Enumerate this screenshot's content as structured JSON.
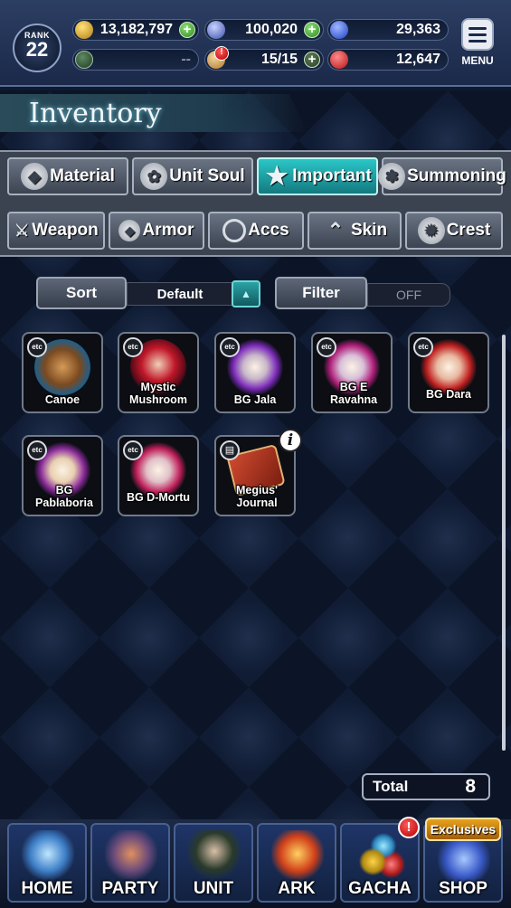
{
  "header": {
    "rank_label": "RANK",
    "rank_value": "22",
    "gold": "13,182,797",
    "gems": "100,020",
    "blue_orbs": "29,363",
    "secondary_currency": "--",
    "stamina": "15/15",
    "red_orbs": "12,647",
    "menu_label": "MENU"
  },
  "page": {
    "title": "Inventory"
  },
  "categories": {
    "row1": [
      {
        "label": "Material",
        "icon": "sack-icon"
      },
      {
        "label": "Unit Soul",
        "icon": "flame-icon"
      },
      {
        "label": "Important",
        "icon": "star-icon",
        "active": true
      },
      {
        "label": "Summoning",
        "icon": "summon-icon"
      }
    ],
    "row2": [
      {
        "label": "Weapon",
        "icon": "sword-icon"
      },
      {
        "label": "Armor",
        "icon": "armor-icon"
      },
      {
        "label": "Accs",
        "icon": "ring-icon"
      },
      {
        "label": "Skin",
        "icon": "hanger-icon"
      },
      {
        "label": "Crest",
        "icon": "crest-icon"
      }
    ]
  },
  "controls": {
    "sort_label": "Sort",
    "sort_value": "Default",
    "filter_label": "Filter",
    "filter_value": "OFF"
  },
  "items": [
    {
      "name": "Canoe",
      "badge": "etc"
    },
    {
      "name": "Mystic Mushroom",
      "badge": "etc"
    },
    {
      "name": "BG Jala",
      "badge": "etc"
    },
    {
      "name": "BG E Ravahna",
      "badge": "etc"
    },
    {
      "name": "BG Dara",
      "badge": "etc"
    },
    {
      "name": "BG Pablaboria",
      "badge": "etc"
    },
    {
      "name": "BG D-Mortu",
      "badge": "etc"
    },
    {
      "name": "Megius' Journal",
      "badge": "book"
    }
  ],
  "total": {
    "label": "Total",
    "value": "8"
  },
  "nav": [
    {
      "label": "HOME"
    },
    {
      "label": "PARTY"
    },
    {
      "label": "UNIT"
    },
    {
      "label": "ARK"
    },
    {
      "label": "GACHA"
    },
    {
      "label": "SHOP"
    }
  ],
  "nav_extras": {
    "shop_banner": "Exclusives",
    "alert_mark": "!",
    "info_mark": "i"
  },
  "colors": {
    "active_tab": "#2bc6c7",
    "background": "#101c34"
  }
}
